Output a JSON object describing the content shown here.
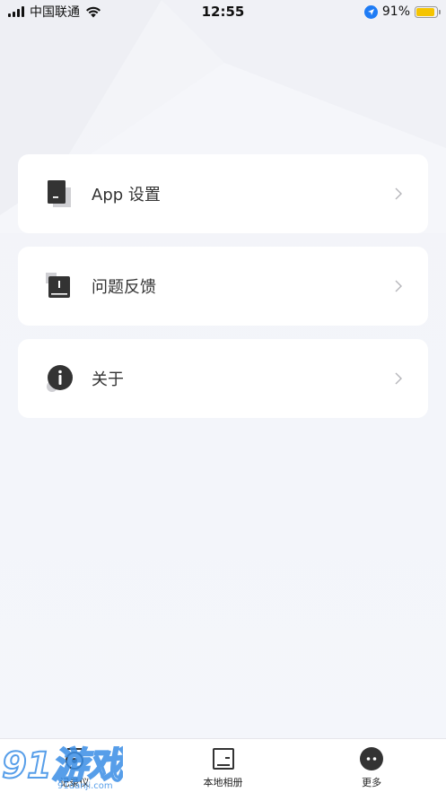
{
  "status_bar": {
    "carrier": "中国联通",
    "time": "12:55",
    "battery_percent_label": "91%",
    "battery_level": 0.91
  },
  "menu": {
    "items": [
      {
        "label": "App 设置",
        "icon": "app-settings-icon"
      },
      {
        "label": "问题反馈",
        "icon": "feedback-icon"
      },
      {
        "label": "关于",
        "icon": "info-icon"
      }
    ]
  },
  "tab_bar": {
    "tabs": [
      {
        "label": "记录仪",
        "icon": "recorder-icon"
      },
      {
        "label": "本地相册",
        "icon": "album-icon"
      },
      {
        "label": "更多",
        "icon": "more-icon"
      }
    ]
  },
  "watermark": {
    "text": "91游戏",
    "url_text": "91danji.com"
  },
  "colors": {
    "background": "#f3f4f8",
    "card": "#ffffff",
    "icon_dark": "#333333",
    "battery": "#f5c400",
    "location_arrow": "#1f7cf5",
    "watermark": "#3a8ee6"
  }
}
